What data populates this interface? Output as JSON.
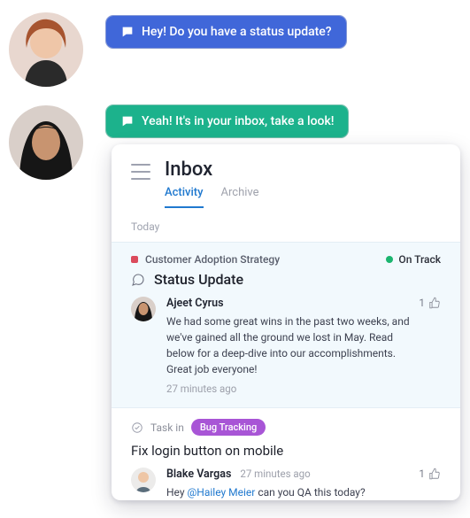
{
  "chat": {
    "msg1": "Hey! Do you have a status update?",
    "msg2": "Yeah! It's in your inbox, take a look!"
  },
  "inbox": {
    "title": "Inbox",
    "tabs": {
      "activity": "Activity",
      "archive": "Archive"
    },
    "section": "Today",
    "item1": {
      "project": "Customer Adoption Strategy",
      "status": "On Track",
      "heading": "Status Update",
      "author": "Ajeet Cyrus",
      "body": "We had some great wins in the past two weeks, and we've gained all the ground we lost in May. Read below for a deep-dive into our accomplishments. Great job everyone!",
      "time": "27 minutes ago",
      "likes": "1"
    },
    "item2": {
      "taskin": "Task in",
      "pill": "Bug Tracking",
      "title": "Fix login button on mobile",
      "author": "Blake Vargas",
      "time": "27 minutes ago",
      "text_pre": "Hey ",
      "mention": "@Hailey Meier",
      "text_post": " can you QA this today?",
      "likes": "1"
    }
  }
}
